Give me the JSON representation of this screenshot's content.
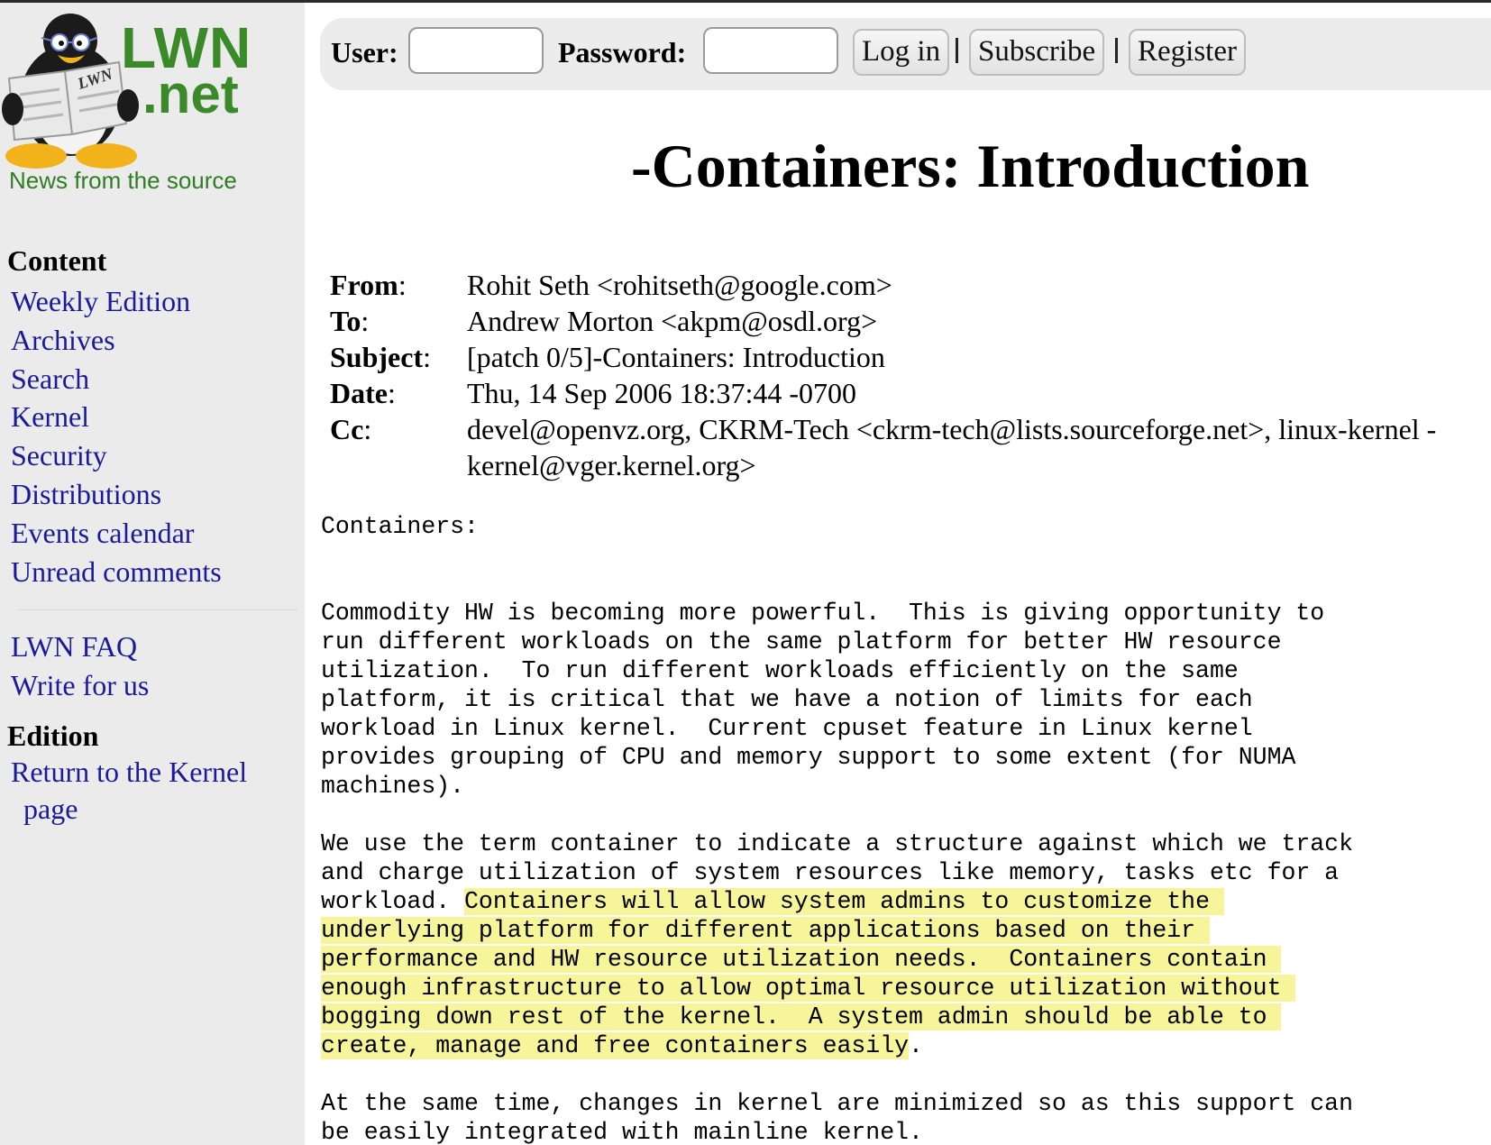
{
  "logo": {
    "wordmark_line1": "LWN",
    "wordmark_line2": ".net",
    "badge_text": "LWN",
    "tagline": "News from the source"
  },
  "sidebar": {
    "content_heading": "Content",
    "content_items": [
      "Weekly Edition",
      "Archives",
      "Search",
      "Kernel",
      "Security",
      "Distributions",
      "Events calendar",
      "Unread comments"
    ],
    "extra_items": [
      "LWN FAQ",
      "Write for us"
    ],
    "edition_heading": "Edition",
    "edition_link": "Return to the Kernel page"
  },
  "login": {
    "user_label": "User:",
    "password_label": "Password:",
    "login_button": "Log in",
    "subscribe_button": "Subscribe",
    "register_button": "Register"
  },
  "article": {
    "title": "-Containers: Introduction",
    "headers": {
      "from_label": "From",
      "from_value": "Rohit Seth <rohitseth@google.com>",
      "to_label": "To",
      "to_value": "Andrew Morton <akpm@osdl.org>",
      "subject_label": "Subject",
      "subject_value": "[patch 0/5]-Containers: Introduction",
      "date_label": "Date",
      "date_value": "Thu, 14 Sep 2006 18:37:44 -0700",
      "cc_label": "Cc",
      "cc_value_line1": "devel@openvz.org, CKRM-Tech <ckrm-tech@lists.sourceforge.net>, linux-kernel -",
      "cc_value_line2": "kernel@vger.kernel.org>"
    },
    "body": {
      "heading": "Containers:",
      "p1": [
        "Commodity HW is becoming more powerful.  This is giving opportunity to",
        "run different workloads on the same platform for better HW resource",
        "utilization.  To run different workloads efficiently on the same",
        "platform, it is critical that we have a notion of limits for each",
        "workload in Linux kernel.  Current cpuset feature in Linux kernel",
        "provides grouping of CPU and memory support to some extent (for NUMA",
        "machines)."
      ],
      "p2_line1": "We use the term container to indicate a structure against which we track",
      "p2_line2": "and charge utilization of system resources like memory, tasks etc for a",
      "p2_line3_plain": "workload. ",
      "p2_line3_hl": "Containers will allow system admins to customize the ",
      "p2_hl_lines": [
        "underlying platform for different applications based on their ",
        "performance and HW resource utilization needs.  Containers contain ",
        "enough infrastructure to allow optimal resource utilization without ",
        "bogging down rest of the kernel.  A system admin should be able to "
      ],
      "p2_last_hl": "create, manage and free containers easily",
      "p2_last_plain": ".",
      "p3": [
        "At the same time, changes in kernel are minimized so as this support can",
        "be easily integrated with mainline kernel."
      ]
    }
  },
  "colors": {
    "link": "#1a1a9a",
    "logo_green": "#3a8a2a",
    "sidebar_bg": "#ebebeb",
    "highlight": "#f7f59a"
  }
}
